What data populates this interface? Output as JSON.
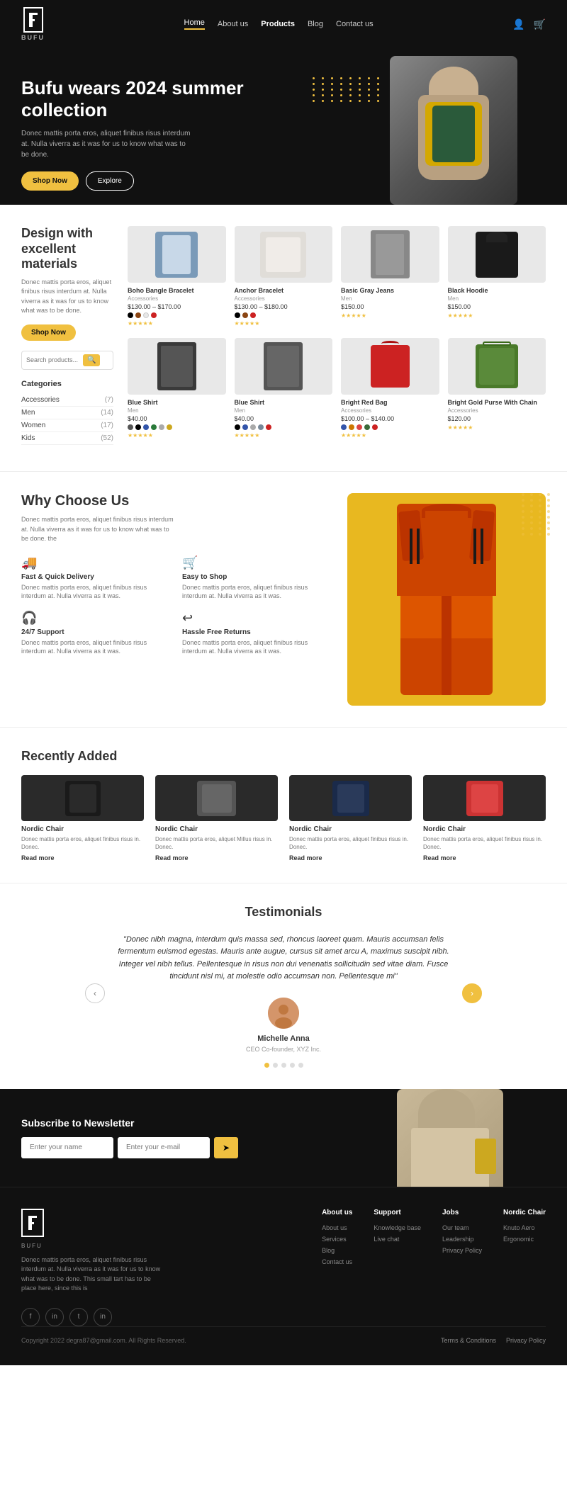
{
  "brand": "BUFU",
  "nav": {
    "links": [
      {
        "label": "Home",
        "active": true
      },
      {
        "label": "About us",
        "active": false
      },
      {
        "label": "Products",
        "active": false,
        "bold": true
      },
      {
        "label": "Blog",
        "active": false
      },
      {
        "label": "Contact us",
        "active": false
      }
    ]
  },
  "hero": {
    "title": "Bufu wears 2024 summer collection",
    "description": "Donec mattis porta eros, aliquet finibus risus interdum at. Nulla viverra as it was for us to know what was to be done.",
    "btn_shop": "Shop Now",
    "btn_explore": "Explore"
  },
  "products_section": {
    "heading": "Design with excellent materials",
    "description": "Donec mattis porta eros, aliquet finibus risus interdum at. Nulla viverra as it was for us to know what was to be done.",
    "btn_shop": "Shop Now",
    "search_placeholder": "Search products...",
    "categories_heading": "Categories",
    "categories": [
      {
        "name": "Accessories",
        "count": "(7)"
      },
      {
        "name": "Men",
        "count": "(14)"
      },
      {
        "name": "Women",
        "count": "(17)"
      },
      {
        "name": "Kids",
        "count": "(52)"
      }
    ],
    "products": [
      {
        "name": "Boho Bangle Bracelet",
        "type": "Accessories",
        "price_range": "$130.00 - $170.00",
        "colors": [
          "#000",
          "#8B4513",
          "#e8e8e8",
          "#cc2222"
        ],
        "color_labels": [
          "Black",
          "Brown",
          "Cream",
          "Red"
        ]
      },
      {
        "name": "Anchor Bracelet",
        "type": "Accessories",
        "price_range": "$130.00 - $180.00",
        "colors": [
          "#000",
          "#8B4513",
          "#cc2222"
        ],
        "color_labels": [
          "Black",
          "Brown",
          "Red"
        ]
      },
      {
        "name": "Basic Gray Jeans",
        "type": "Men",
        "price": "$150.00"
      },
      {
        "name": "Black Hoodie",
        "type": "Men",
        "price": "$150.00"
      },
      {
        "name": "Blue Shirt",
        "type": "Men",
        "price": "$40.00",
        "colors": [
          "#3a3a3a",
          "#000",
          "#3355aa",
          "#2a7a3a",
          "#aaa",
          "#cca820"
        ],
        "color_labels": [
          "Gray",
          "Black",
          "Blue",
          "Green",
          "White",
          "Yellow"
        ]
      },
      {
        "name": "Blue Shirt",
        "type": "Men",
        "price": "$40.00",
        "colors": [
          "#000",
          "#3355aa",
          "#aaa",
          "#778899",
          "#cc2222"
        ],
        "color_labels": [
          "Black",
          "Blue",
          "White",
          "Denim",
          "Red"
        ]
      },
      {
        "name": "Bright Red Bag",
        "type": "Accessories",
        "price_range": "$100.00 - $140.00",
        "colors": [
          "#3355aa",
          "#cc7700",
          "#dd4444",
          "#3a6a3a",
          "#cc2222"
        ],
        "color_labels": [
          "Blue",
          "Orange",
          "Pink",
          "Green",
          "Red"
        ]
      },
      {
        "name": "Bright Gold Purse With Chain",
        "type": "Accessories",
        "price": "$120.00"
      }
    ]
  },
  "why_section": {
    "heading": "Why Choose Us",
    "description": "Donec mattis porta eros, aliquet finibus risus interdum at. Nulla viverra as it was for us to know what was to be done. the",
    "features": [
      {
        "icon": "🚚",
        "title": "Fast & Quick Delivery",
        "description": "Donec mattis porta eros, aliquet finibus risus interdum at. Nulla viverra as it was."
      },
      {
        "icon": "🛒",
        "title": "Easy to Shop",
        "description": "Donec mattis porta eros, aliquet finibus risus interdum at. Nulla viverra as it was."
      },
      {
        "icon": "🎧",
        "title": "24/7 Support",
        "description": "Donec mattis porta eros, aliquet finibus risus interdum at. Nulla viverra as it was."
      },
      {
        "icon": "↩",
        "title": "Hassle Free Returns",
        "description": "Donec mattis porta eros, aliquet finibus risus interdum at. Nulla viverra as it was."
      }
    ]
  },
  "recently_added": {
    "heading": "Recently Added",
    "items": [
      {
        "name": "Nordic Chair",
        "description": "Donec mattis porta eros, aliquet finibus risus in. Donec.",
        "read_more": "Read more"
      },
      {
        "name": "Nordic Chair",
        "description": "Donec mattis porta eros, aliquet Millus risus in. Donec.",
        "read_more": "Read more"
      },
      {
        "name": "Nordic Chair",
        "description": "Donec mattis porta eros, aliquet finibus risus in. Donec.",
        "read_more": "Read more"
      },
      {
        "name": "Nordic Chair",
        "description": "Donec mattis porta eros, aliquet finibus risus in. Donec.",
        "read_more": "Read more"
      }
    ]
  },
  "testimonials": {
    "heading": "Testimonials",
    "quote": "\"Donec nibh magna, interdum quis massa sed, rhoncus laoreet quam. Mauris accumsan felis fermentum euismod egestas. Mauris ante augue, cursus sit amet arcu A, maximus suscipit nibh. Integer vel nibh tellus. Pellentesque in risus non dui venenatis sollicitudin sed vitae diam. Fusce tincidunt nisl mi, at molestie odio accumsan non. Pellentesque mi\"",
    "author_name": "Michelle Anna",
    "author_role": "CEO Co-founder, XYZ Inc.",
    "nav_dots": 5
  },
  "newsletter": {
    "heading": "Subscribe to Newsletter",
    "name_placeholder": "Enter your name",
    "email_placeholder": "Enter your e-mail",
    "btn_label": "➤"
  },
  "footer": {
    "tagline": "Donec mattis porta eros, aliquet finibus risus interdum at. Nulla viverra as it was for us to know what was to be done. This small tart has to be place here, since this is",
    "columns": [
      {
        "heading": "About us",
        "links": [
          "About us",
          "Services",
          "Blog",
          "Contact us"
        ]
      },
      {
        "heading": "Support",
        "links": [
          "Knowledge base",
          "Live chat"
        ]
      },
      {
        "heading": "Jobs",
        "links": [
          "Our team",
          "Leadership",
          "Privacy Policy"
        ]
      },
      {
        "heading": "Nordic Chair",
        "links": [
          "Knuto Aero",
          "Ergonomic"
        ]
      }
    ],
    "social_icons": [
      "f",
      "in",
      "t",
      "in"
    ],
    "copyright": "Copyright 2022 degra87@gmail.com. All Rights Reserved.",
    "bottom_links": [
      "Terms & Conditions",
      "Privacy Policy"
    ]
  }
}
